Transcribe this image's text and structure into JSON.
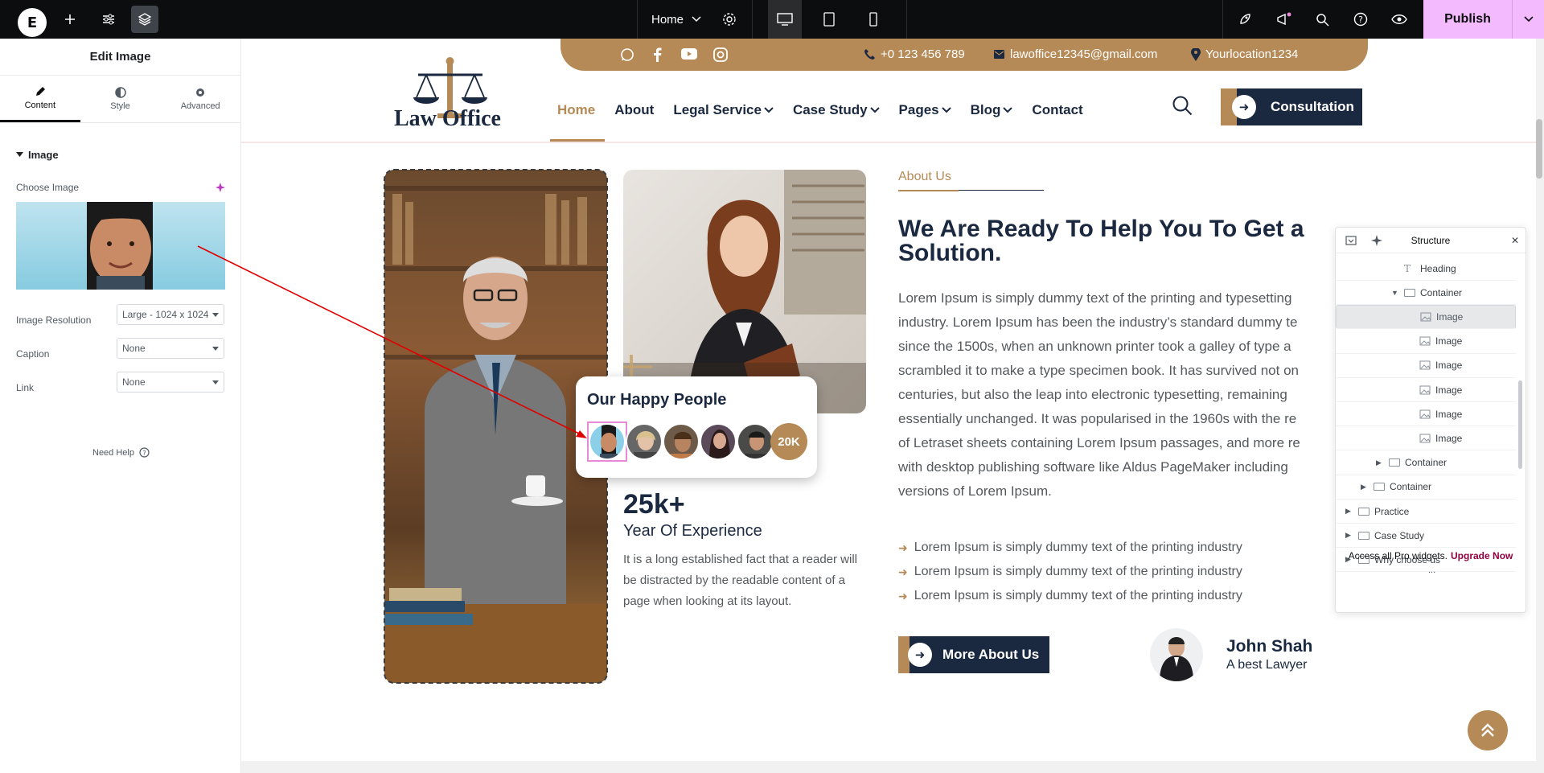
{
  "topbar": {
    "page_name": "Home",
    "publish_label": "Publish"
  },
  "panel": {
    "title": "Edit Image",
    "tabs": [
      {
        "label": "Content"
      },
      {
        "label": "Style"
      },
      {
        "label": "Advanced"
      }
    ],
    "section": "Image",
    "choose_image_label": "Choose Image",
    "resolution_label": "Image Resolution",
    "resolution_value": "Large - 1024 x 1024",
    "caption_label": "Caption",
    "caption_value": "None",
    "link_label": "Link",
    "link_value": "None",
    "need_help": "Need Help"
  },
  "site": {
    "phone": "+0 123 456 789",
    "email": "lawoffice12345@gmail.com",
    "location": "Yourlocation1234",
    "logo_text": "Law Office",
    "nav": [
      {
        "label": "Home",
        "active": true
      },
      {
        "label": "About"
      },
      {
        "label": "Legal Service",
        "caret": true
      },
      {
        "label": "Case Study",
        "caret": true
      },
      {
        "label": "Pages",
        "caret": true
      },
      {
        "label": "Blog",
        "caret": true
      },
      {
        "label": "Contact"
      }
    ],
    "cta_label": "Consultation",
    "happy_title": "Our Happy People",
    "happy_count": "20K",
    "exp_number": "25k+",
    "exp_label": "Year Of Experience",
    "exp_text": "It is a long established fact that a reader will be distracted by the readable content of a page when looking at its layout.",
    "about_tag": "About Us",
    "about_heading": "We Are Ready To Help You To Get a Solution.",
    "about_lines": [
      "Lorem Ipsum is simply dummy text of the printing and typesetting",
      "industry. Lorem Ipsum has been the industry’s standard dummy te",
      "since the 1500s, when an unknown printer took a galley of type a",
      "scrambled it to make a type specimen book. It has survived not on",
      "centuries, but also the leap into electronic typesetting, remaining",
      "essentially unchanged. It was popularised in the 1960s with the re",
      "of Letraset sheets containing Lorem Ipsum passages, and more re",
      "with desktop publishing software like Aldus PageMaker including",
      "versions of Lorem Ipsum."
    ],
    "bullets": [
      "Lorem Ipsum is simply dummy text of the printing industry",
      "Lorem Ipsum is simply dummy text of the printing industry",
      "Lorem Ipsum is simply dummy text of the printing industry"
    ],
    "more_label": "More About Us",
    "john_name": "John Shah",
    "john_role": "A best Lawyer"
  },
  "structure": {
    "title": "Structure",
    "rows": [
      {
        "label": "Heading",
        "icon": "heading-icon",
        "indent": 3
      },
      {
        "label": "Container",
        "icon": "container-icon",
        "indent": 3,
        "expanded": true
      },
      {
        "label": "Image",
        "icon": "image-icon",
        "indent": 4,
        "selected": true
      },
      {
        "label": "Image",
        "icon": "image-icon",
        "indent": 4
      },
      {
        "label": "Image",
        "icon": "image-icon",
        "indent": 4
      },
      {
        "label": "Image",
        "icon": "image-icon",
        "indent": 4
      },
      {
        "label": "Image",
        "icon": "image-icon",
        "indent": 4
      },
      {
        "label": "Image",
        "icon": "image-icon",
        "indent": 4
      },
      {
        "label": "Container",
        "icon": "container-icon",
        "indent": 2,
        "collapsed": true
      },
      {
        "label": "Container",
        "icon": "container-icon",
        "indent": 1,
        "collapsed": true
      },
      {
        "label": "Practice",
        "icon": "container-icon",
        "indent": 0,
        "collapsed": true
      },
      {
        "label": "Case Study",
        "icon": "container-icon",
        "indent": 0,
        "collapsed": true
      },
      {
        "label": "Why choose us",
        "icon": "container-icon",
        "indent": 0,
        "collapsed": true
      }
    ],
    "footer_text": "Access all Pro widgets.",
    "upgrade_label": "Upgrade Now",
    "more_dots": "..."
  },
  "colors": {
    "brand_gold": "#b58a56",
    "brand_navy": "#1b2940",
    "publish_pink": "#f3bafd",
    "arrow_red": "#e00000"
  }
}
